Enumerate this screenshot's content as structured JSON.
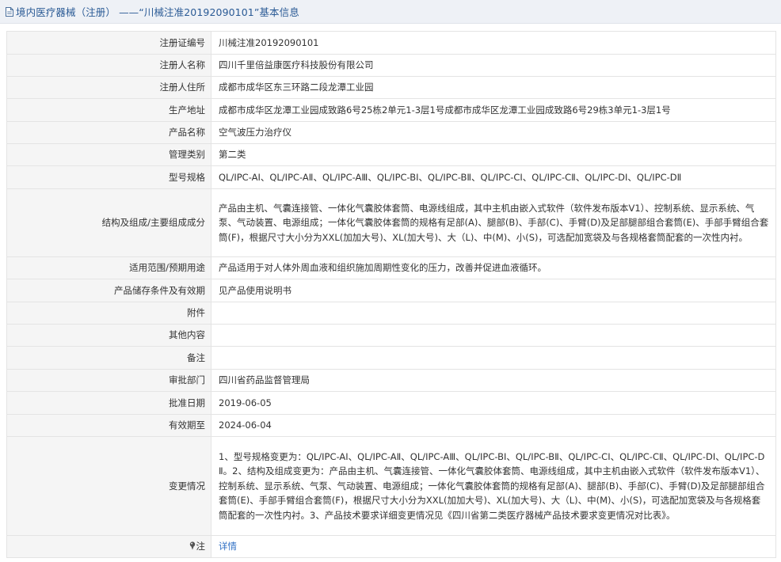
{
  "header": {
    "icon": "document-icon",
    "title": "境内医疗器械（注册） ——“川械注准20192090101”基本信息"
  },
  "rows": [
    {
      "label": "注册证编号",
      "value": "川械注准20192090101"
    },
    {
      "label": "注册人名称",
      "value": "四川千里倍益康医疗科技股份有限公司"
    },
    {
      "label": "注册人住所",
      "value": "成都市成华区东三环路二段龙潭工业园"
    },
    {
      "label": "生产地址",
      "value": "成都市成华区龙潭工业园成致路6号25栋2单元1-3层1号成都市成华区龙潭工业园成致路6号29栋3单元1-3层1号"
    },
    {
      "label": "产品名称",
      "value": "空气波压力治疗仪"
    },
    {
      "label": "管理类别",
      "value": "第二类"
    },
    {
      "label": "型号规格",
      "value": "QL/IPC-AⅠ、QL/IPC-AⅡ、QL/IPC-AⅢ、QL/IPC-BⅠ、QL/IPC-BⅡ、QL/IPC-CⅠ、QL/IPC-CⅡ、QL/IPC-DⅠ、QL/IPC-DⅡ"
    },
    {
      "label": "结构及组成/主要组成成分",
      "value": "产品由主机、气囊连接管、一体化气囊胶体套筒、电源线组成，其中主机由嵌入式软件（软件发布版本V1）、控制系统、显示系统、气泵、气动装置、电源组成；一体化气囊胶体套筒的规格有足部(A)、腿部(B)、手部(C)、手臂(D)及足部腿部组合套筒(E)、手部手臂组合套筒(F)，根据尺寸大小分为XXL(加加大号)、XL(加大号)、大（L)、中(M)、小(S)，可选配加宽袋及与各规格套筒配套的一次性内衬。"
    },
    {
      "label": "适用范围/预期用途",
      "value": "产品适用于对人体外周血液和组织施加周期性变化的压力，改善并促进血液循环。"
    },
    {
      "label": "产品储存条件及有效期",
      "value": "见产品使用说明书"
    },
    {
      "label": "附件",
      "value": ""
    },
    {
      "label": "其他内容",
      "value": ""
    },
    {
      "label": "备注",
      "value": ""
    },
    {
      "label": "审批部门",
      "value": "四川省药品监督管理局"
    },
    {
      "label": "批准日期",
      "value": "2019-06-05"
    },
    {
      "label": "有效期至",
      "value": "2024-06-04"
    },
    {
      "label": "变更情况",
      "value": "1、型号规格变更为：QL/IPC-AⅠ、QL/IPC-AⅡ、QL/IPC-AⅢ、QL/IPC-BⅠ、QL/IPC-BⅡ、QL/IPC-CⅠ、QL/IPC-CⅡ、QL/IPC-DⅠ、QL/IPC-DⅡ。2、结构及组成变更为：产品由主机、气囊连接管、一体化气囊胶体套筒、电源线组成，其中主机由嵌入式软件（软件发布版本V1）、控制系统、显示系统、气泵、气动装置、电源组成；一体化气囊胶体套筒的规格有足部(A)、腿部(B)、手部(C)、手臂(D)及足部腿部组合套筒(E)、手部手臂组合套筒(F)，根据尺寸大小分为XXL(加加大号)、XL(加大号)、大（L)、中(M)、小(S)，可选配加宽袋及与各规格套筒配套的一次性内衬。3、产品技术要求详细变更情况见《四川省第二类医疗器械产品技术要求变更情况对比表》。"
    }
  ],
  "note": {
    "icon": "pin-icon",
    "label": "注",
    "link_text": "详情"
  },
  "colors": {
    "header_bg": "#eef1f6",
    "title_text": "#2a5a95",
    "label_bg": "#f5f5f5",
    "border": "#e4e4e4",
    "link": "#2f6fc4"
  }
}
